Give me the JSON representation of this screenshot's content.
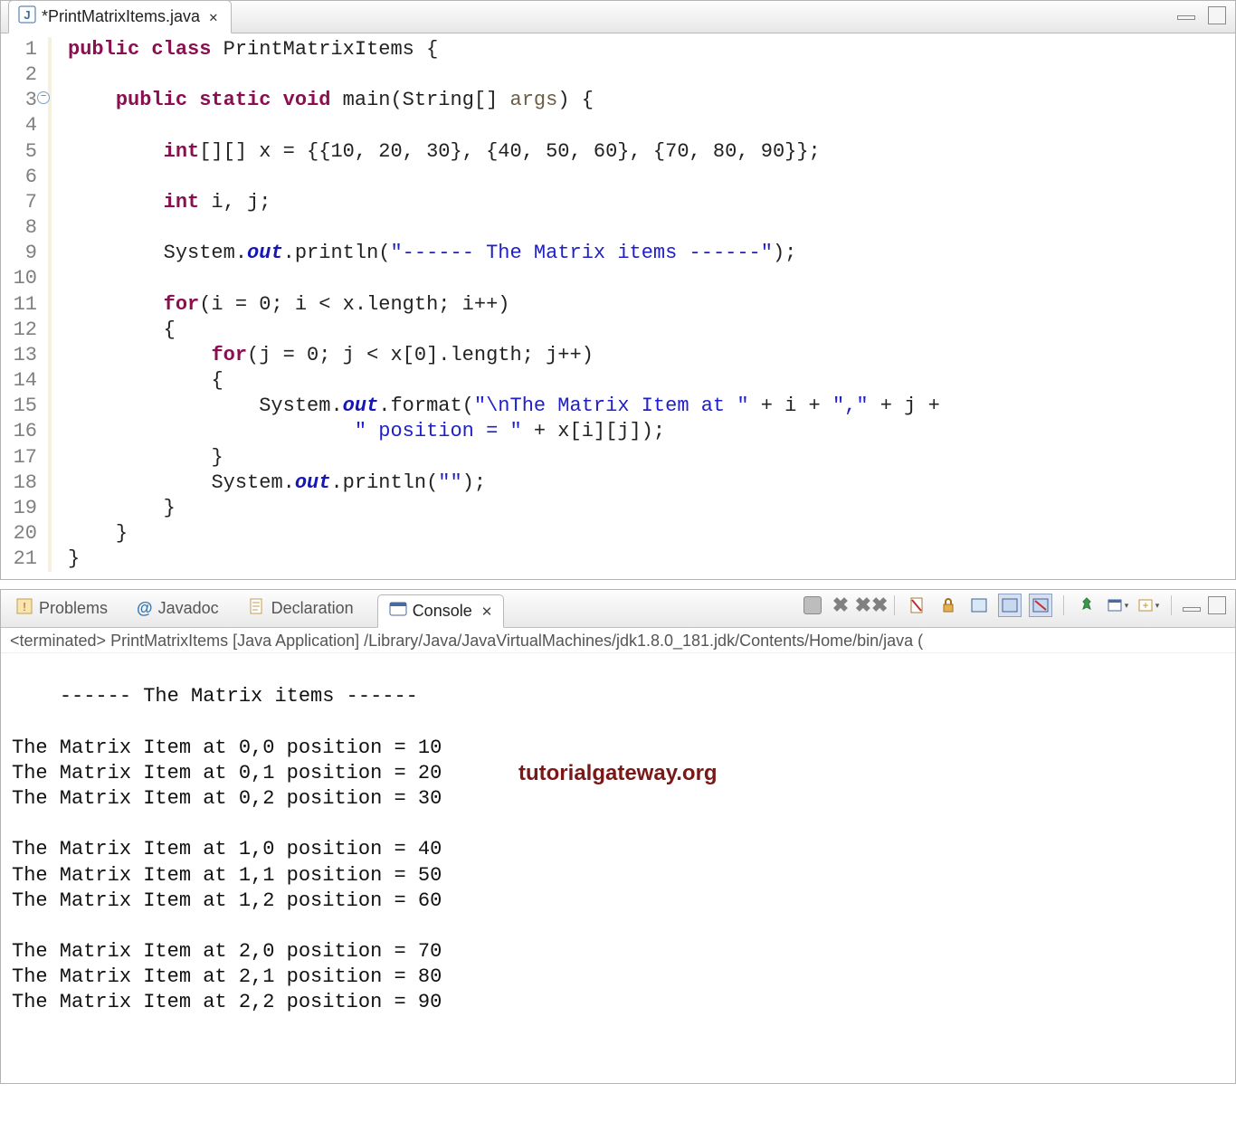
{
  "editor": {
    "tab_title": "*PrintMatrixItems.java",
    "lines": {
      "1": {
        "pre": "",
        "html": "<span class='kw'>public</span> <span class='kw'>class</span> <span class='cls'>PrintMatrixItems {</span>"
      },
      "2": {
        "pre": "",
        "html": ""
      },
      "3": {
        "pre": "    ",
        "html": "<span class='kw'>public</span> <span class='kw'>static</span> <span class='kw'>void</span> <span class='cls'>main(String[] </span><span class='param'>args</span><span class='cls'>) {</span>"
      },
      "4": {
        "pre": "",
        "html": ""
      },
      "5": {
        "pre": "        ",
        "html": "<span class='kw'>int</span><span class='plain'>[][] x = {{10, 20, 30}, {40, 50, 60}, {70, 80, 90}};</span>"
      },
      "6": {
        "pre": "",
        "html": ""
      },
      "7": {
        "pre": "        ",
        "html": "<span class='kw'>int</span><span class='plain'> i, j;</span>"
      },
      "8": {
        "pre": "",
        "html": ""
      },
      "9": {
        "pre": "        ",
        "html": "<span class='plain'>System.</span><span class='field'>out</span><span class='plain'>.println(</span><span class='str'>\"------ The Matrix items ------\"</span><span class='plain'>);</span>"
      },
      "10": {
        "pre": "",
        "html": ""
      },
      "11": {
        "pre": "        ",
        "html": "<span class='kw'>for</span><span class='plain'>(i = 0; i &lt; x.length; i++)</span>"
      },
      "12": {
        "pre": "        ",
        "html": "<span class='plain'>{</span>"
      },
      "13": {
        "pre": "            ",
        "html": "<span class='kw'>for</span><span class='plain'>(j = 0; j &lt; x[0].length; j++)</span>"
      },
      "14": {
        "pre": "            ",
        "html": "<span class='plain'>{</span>"
      },
      "15": {
        "pre": "                ",
        "html": "<span class='plain'>System.</span><span class='field'>out</span><span class='plain'>.format(</span><span class='str'>\"\\nThe Matrix Item at \"</span><span class='plain'> + i + </span><span class='str'>\",\"</span><span class='plain'> + j +</span>"
      },
      "16": {
        "pre": "                        ",
        "html": "<span class='str'>\" position = \"</span><span class='plain'> + x[i][j]);</span>"
      },
      "17": {
        "pre": "            ",
        "html": "<span class='plain'>}</span>"
      },
      "18": {
        "pre": "            ",
        "html": "<span class='plain'>System.</span><span class='field'>out</span><span class='plain'>.println(</span><span class='str'>\"\"</span><span class='plain'>);</span>"
      },
      "19": {
        "pre": "        ",
        "html": "<span class='plain'>}</span>"
      },
      "20": {
        "pre": "    ",
        "html": "<span class='plain'>}</span>"
      },
      "21": {
        "pre": "",
        "html": "<span class='plain'>}</span>"
      }
    },
    "line_numbers": [
      "1",
      "2",
      "3",
      "4",
      "5",
      "6",
      "7",
      "8",
      "9",
      "10",
      "11",
      "12",
      "13",
      "14",
      "15",
      "16",
      "17",
      "18",
      "19",
      "20",
      "21"
    ]
  },
  "views": {
    "tabs": {
      "problems": "Problems",
      "javadoc": "Javadoc",
      "declaration": "Declaration",
      "console": "Console"
    },
    "status_line": "<terminated> PrintMatrixItems [Java Application] /Library/Java/JavaVirtualMachines/jdk1.8.0_181.jdk/Contents/Home/bin/java  (",
    "console_output": "------ The Matrix items ------\n\nThe Matrix Item at 0,0 position = 10\nThe Matrix Item at 0,1 position = 20\nThe Matrix Item at 0,2 position = 30\n\nThe Matrix Item at 1,0 position = 40\nThe Matrix Item at 1,1 position = 50\nThe Matrix Item at 1,2 position = 60\n\nThe Matrix Item at 2,0 position = 70\nThe Matrix Item at 2,1 position = 80\nThe Matrix Item at 2,2 position = 90"
  },
  "watermark": "tutorialgateway.org"
}
